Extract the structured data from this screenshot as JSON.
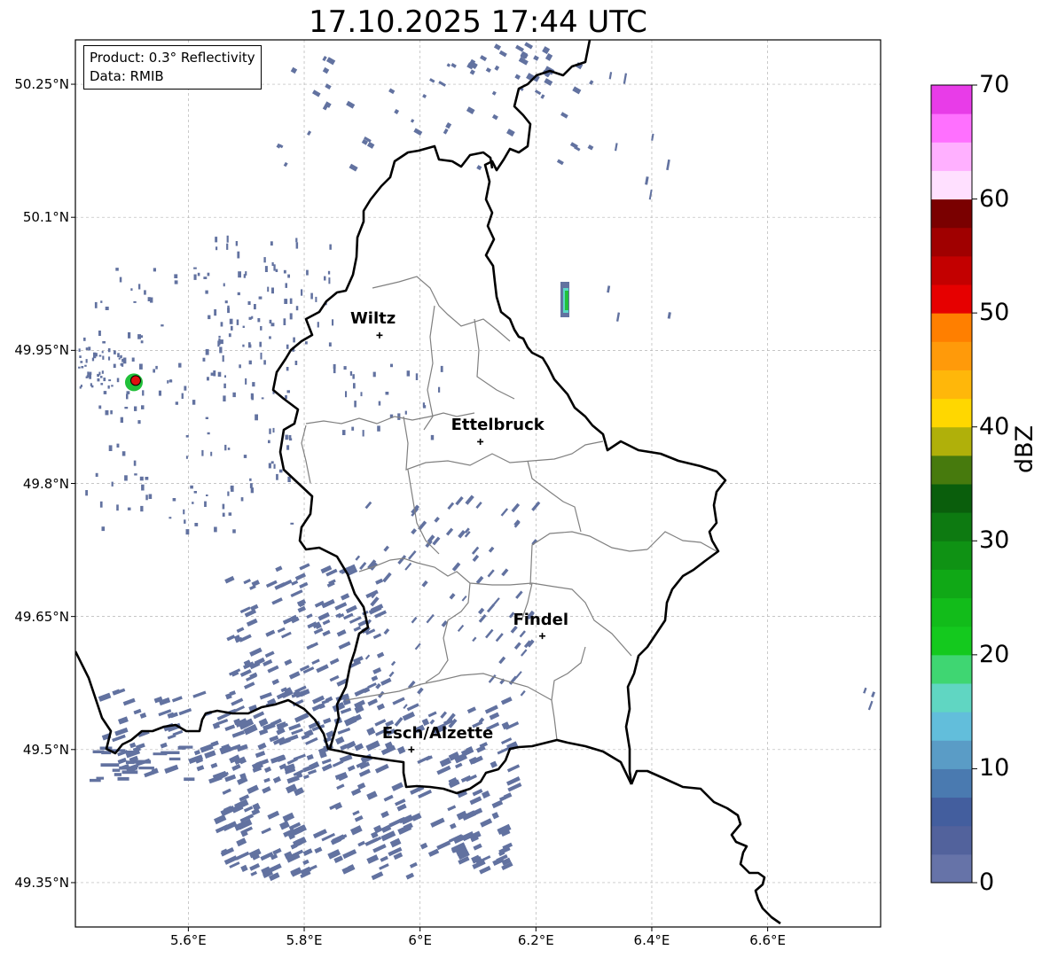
{
  "title": "17.10.2025 17:44 UTC",
  "info_box": {
    "product": "Product: 0.3° Reflectivity",
    "data": "Data: RMIB"
  },
  "map_extent": {
    "lon": [
      5.405,
      6.795
    ],
    "lat": [
      49.3,
      50.3
    ]
  },
  "lat_ticks": [
    {
      "value": 50.25,
      "label": "50.25°N"
    },
    {
      "value": 50.1,
      "label": "50.1°N"
    },
    {
      "value": 49.95,
      "label": "49.95°N"
    },
    {
      "value": 49.8,
      "label": "49.8°N"
    },
    {
      "value": 49.65,
      "label": "49.65°N"
    },
    {
      "value": 49.5,
      "label": "49.5°N"
    },
    {
      "value": 49.35,
      "label": "49.35°N"
    }
  ],
  "lon_ticks": [
    {
      "value": 5.6,
      "label": "5.6°E"
    },
    {
      "value": 5.8,
      "label": "5.8°E"
    },
    {
      "value": 6.0,
      "label": "6°E"
    },
    {
      "value": 6.2,
      "label": "6.2°E"
    },
    {
      "value": 6.4,
      "label": "6.4°E"
    },
    {
      "value": 6.6,
      "label": "6.6°E"
    }
  ],
  "cities": [
    {
      "name": "Wiltz",
      "lon": 5.93,
      "lat": 49.967
    },
    {
      "name": "Ettelbruck",
      "lon": 6.104,
      "lat": 49.847
    },
    {
      "name": "Findel",
      "lon": 6.211,
      "lat": 49.628
    },
    {
      "name": "Esch/Alzette",
      "lon": 5.985,
      "lat": 49.5
    }
  ],
  "radar_site": {
    "lon": 5.506,
    "lat": 49.914,
    "marker_color": "#e01010"
  },
  "colorbar": {
    "label": "dBZ",
    "min": 0,
    "max": 70,
    "step": 2.5,
    "tick_labels": [
      "0",
      "10",
      "20",
      "30",
      "40",
      "50",
      "60",
      "70"
    ],
    "colors": [
      "#6673a8",
      "#52629c",
      "#435e9e",
      "#4a7ab0",
      "#5a9cc6",
      "#62bedb",
      "#60d6c2",
      "#3fd672",
      "#14c91e",
      "#12bc1a",
      "#10a816",
      "#0f9214",
      "#0d7a11",
      "#0a5e0c",
      "#477a0d",
      "#b0b00a",
      "#ffd700",
      "#ffb70a",
      "#ff9a0a",
      "#ff7f00",
      "#e60000",
      "#c30000",
      "#a00000",
      "#7a0000",
      "#ffe0ff",
      "#ffb0ff",
      "#ff70ff",
      "#e83ce8"
    ]
  },
  "colors": {
    "border": "#000000",
    "district": "#808080",
    "grid": "#b4b4b4",
    "echo": "#6272a0",
    "echo_green": "#22c03a",
    "echo_cyan": "#5cd6c6"
  }
}
